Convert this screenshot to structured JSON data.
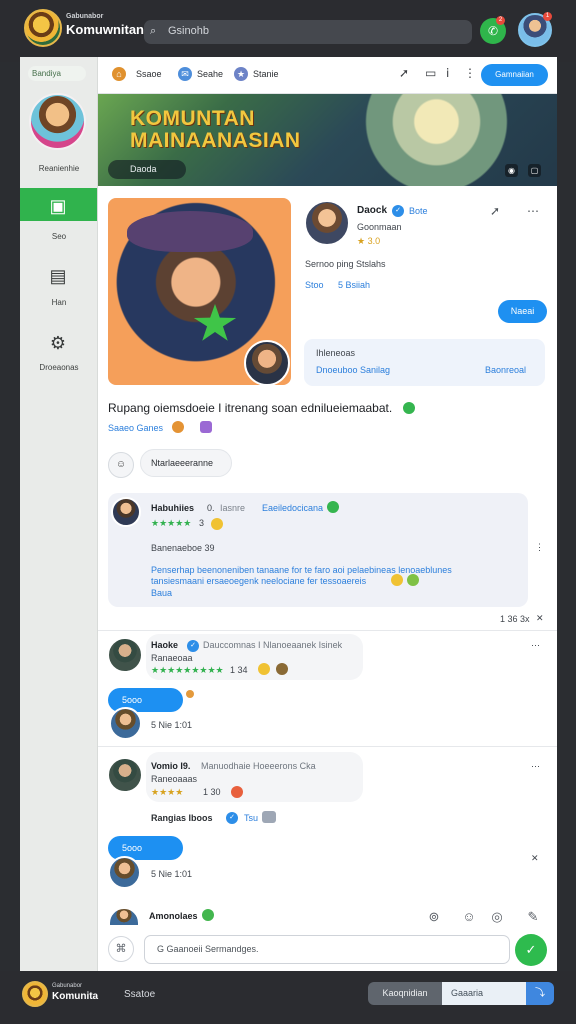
{
  "topbar": {
    "brand_small": "Gabunabor",
    "brand_title": "Komuwnitan",
    "search_placeholder": "Gsinohb",
    "green_button_badge": "2",
    "avatar_badge": "1"
  },
  "sidebar": {
    "pill": "Bandiya",
    "profile_label": "Reanienhie",
    "items": [
      {
        "label": "Seo",
        "icon": "community-icon"
      },
      {
        "label": "Han",
        "icon": "document-icon"
      },
      {
        "label": "Droeaonas",
        "icon": "settings-icon"
      }
    ]
  },
  "header": {
    "tabs": [
      "Ssaoe",
      "Seahe",
      "Stanie"
    ],
    "join_label": "Gamnaiian"
  },
  "banner": {
    "title_line1": "KOMUNTAN",
    "title_line2": "MAINAANASIAN",
    "pill_label": "Daoda",
    "chip1": "◉",
    "chip2": "▢"
  },
  "post": {
    "author": "Daock",
    "verified_label": "Bote",
    "subtitle": "Goonmaan",
    "rating": "★ 3.0",
    "badge_text": "Sernoo ping Stslahs",
    "meta_left": "Stoo",
    "meta_right": "5 Bsiiah",
    "follow_label": "Naeai",
    "info_title": "Ihleneoas",
    "info_left": "Dnoeuboo Sanilag",
    "info_right": "Baonreoal",
    "caption": "Rupang oiemsdoeie I itrenang soan ednilueiemaabat.",
    "tag_text": "Saaeo Ganes"
  },
  "message_pill": "Ntarlaeeeranne",
  "comment_card": {
    "author": "Habuhiies",
    "time": "0.",
    "meta": "Iasnre",
    "link": "Eaeiledocicana",
    "stars": "★★★★★",
    "count": "3",
    "subheading": "Banenaeboe 39",
    "body_line1": "Penserhap beenoneniben tanaane for te faro aoi pelaebineas lenoaeblunes",
    "body_line2": "tansiesmaani ersaeoegenk neelociane fer tessoaereis",
    "body_line3": "Baua",
    "foot_count": "1 36 3x"
  },
  "comments": [
    {
      "author": "Haoke",
      "meta": "Dauccomnas I Nlanoeaanek Isinek",
      "sub": "Ranaeoaa",
      "stars": "★★★★★★★★★",
      "count": "1 34",
      "reply_label": "5ooo",
      "reply_meta": "5 Nie 1:01"
    },
    {
      "author": "Vomio I9.",
      "meta": "Manuodhaie Hoeeerons Cka",
      "sub": "Raneoaaas",
      "stars": "★★★★",
      "count": "1 30",
      "extra": "Rangias Iboos",
      "extra_tail": "Tsu",
      "reply_label": "5ooo",
      "reply_meta": "5 Nie 1:01"
    }
  ],
  "bottom": {
    "active_user": "Amonolaes",
    "composer_placeholder": "G Gaanoeii Sermandges.",
    "send": "✓"
  },
  "footer": {
    "brand_small": "Gabunabor",
    "brand_title": "Komunita",
    "middle_text": "Ssatoe",
    "segment_label": "Kaoqnidian",
    "input_placeholder": "Gaaaria",
    "button_icon": "⤵"
  }
}
